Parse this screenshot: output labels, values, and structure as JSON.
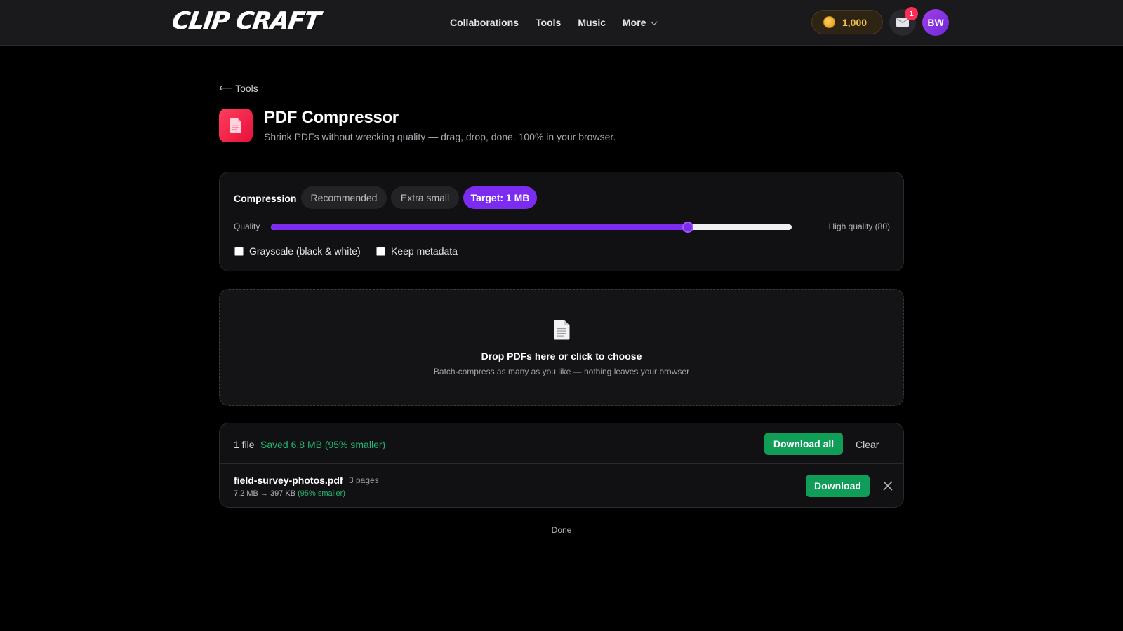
{
  "nav": {
    "logo": "CLIP CRAFT",
    "links": [
      "Collaborations",
      "Tools",
      "Music"
    ],
    "more_label": "More",
    "coins": "1,000",
    "notification_count": "1",
    "avatar_initials": "BW"
  },
  "header": {
    "back_label": "Tools",
    "title": "PDF Compressor",
    "subtitle": "Shrink PDFs without wrecking quality — drag, drop, done. 100% in your browser."
  },
  "settings": {
    "compression_label": "Compression",
    "presets": [
      "Recommended",
      "Extra small",
      "Target: 1 MB"
    ],
    "active_preset": "Target: 1 MB",
    "quality_label": "Quality",
    "quality_value": 80,
    "quality_min": 0,
    "quality_max": 100,
    "quality_text": "High quality (80)",
    "grayscale_label": "Grayscale (black & white)",
    "grayscale_checked": false,
    "metadata_label": "Keep metadata",
    "metadata_checked": false
  },
  "dropzone": {
    "title": "Drop PDFs here or click to choose",
    "subtitle": "Batch-compress as many as you like — nothing leaves your browser"
  },
  "files": {
    "count_label": "1 file",
    "saved_label": "Saved 6.8 MB (95% smaller)",
    "download_all_label": "Download all",
    "clear_label": "Clear",
    "items": [
      {
        "name": "field-survey-photos.pdf",
        "pages": "3 pages",
        "sizes": "7.2 MB → 397 KB",
        "reduction": "(95% smaller)",
        "download_label": "Download"
      }
    ]
  },
  "status": "Done",
  "colors": {
    "accent": "#7c2cf0",
    "success": "#0f9d58",
    "saved_text": "#22b573",
    "app_icon": "#ff3d5e",
    "background": "#000000"
  }
}
